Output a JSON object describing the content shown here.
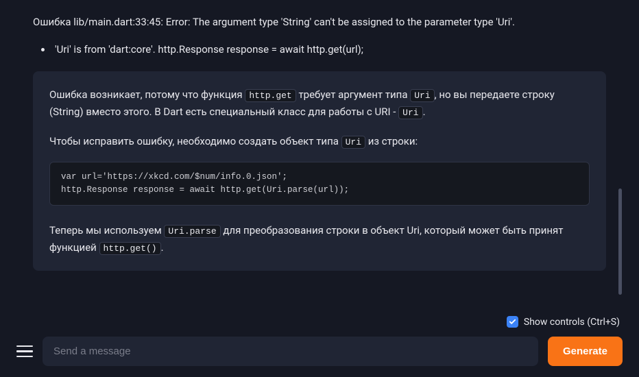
{
  "user": {
    "error_line": "Ошибка lib/main.dart:33:45: Error: The argument type 'String' can't be assigned to the parameter type 'Uri'.",
    "bullet": "'Uri' is from 'dart:core'. http.Response response = await http.get(url);"
  },
  "assistant": {
    "p1_pre": "Ошибка возникает, потому что функция ",
    "code1": "http.get",
    "p1_mid": " требует аргумент типа ",
    "code2": "Uri",
    "p1_mid2": ", но вы передаете строку (String) вместо этого. В Dart есть специальный класс для работы с URI - ",
    "code3": "Uri",
    "p1_end": ".",
    "p2_pre": "Чтобы исправить ошибку, необходимо создать объект типа ",
    "code4": "Uri",
    "p2_end": " из строки:",
    "codeblock": "var url='https://xkcd.com/$num/info.0.json';\nhttp.Response response = await http.get(Uri.parse(url));",
    "p3_pre": "Теперь мы используем ",
    "code5": "Uri.parse",
    "p3_mid": " для преобразования строки в объект Uri, который может быть принят функцией ",
    "code6": "http.get()",
    "p3_end": "."
  },
  "footer": {
    "checkbox_label": "Show controls (Ctrl+S)",
    "input_placeholder": "Send a message",
    "button_label": "Generate"
  }
}
